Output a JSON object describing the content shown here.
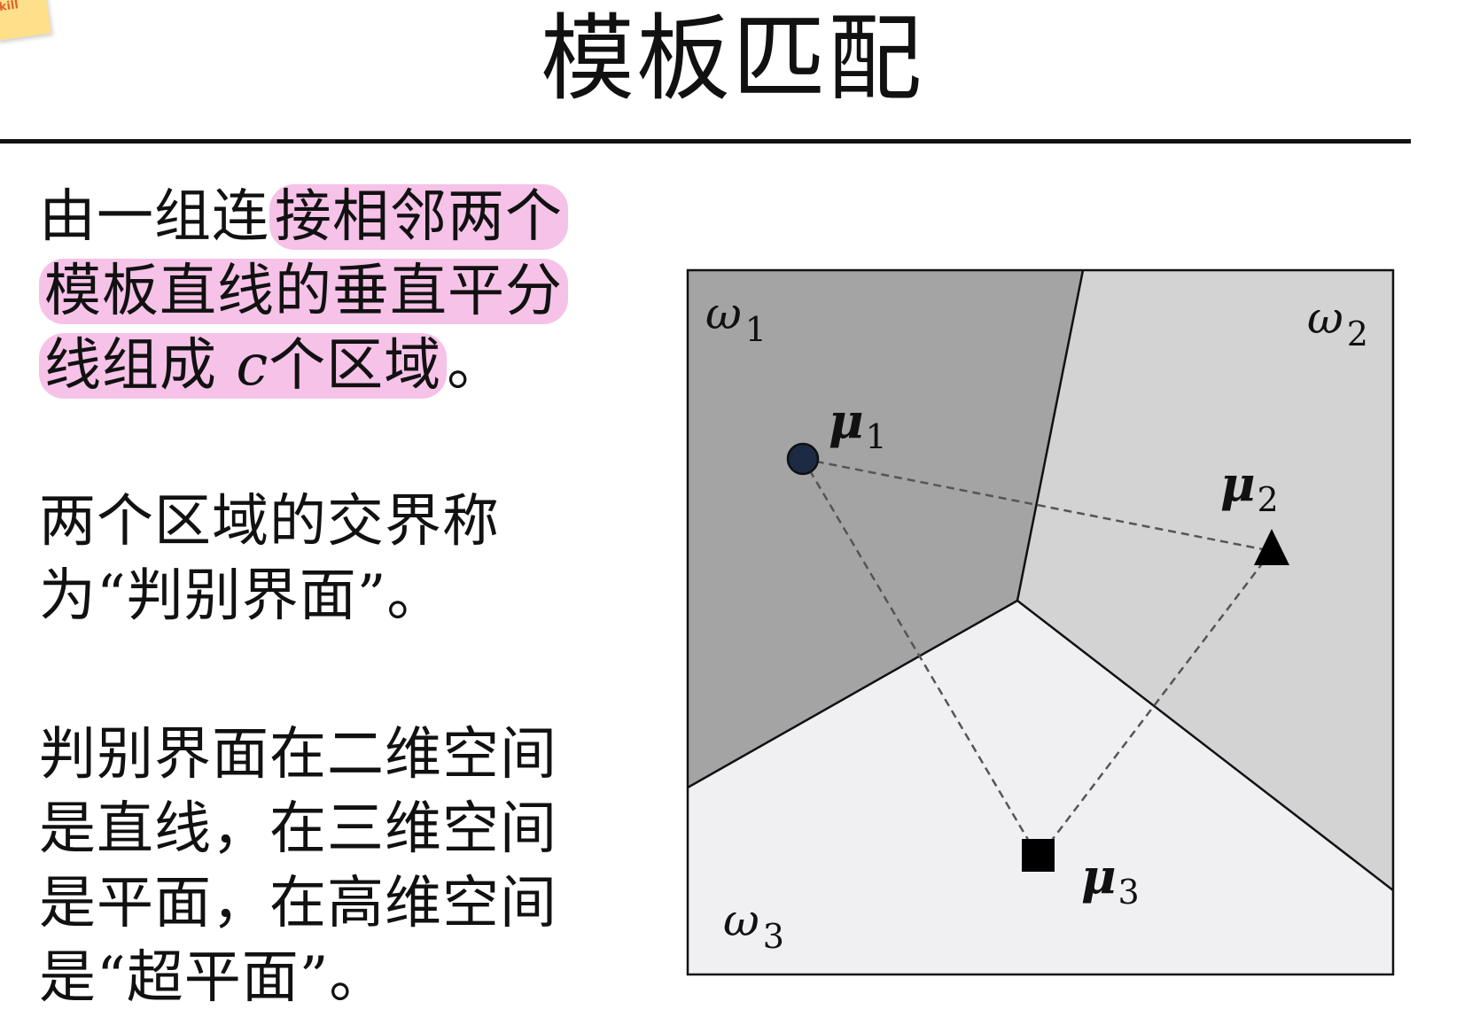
{
  "sticky_note": {
    "text": "kill"
  },
  "title": "模板匹配",
  "paragraphs": {
    "p1": {
      "before": "由一组连",
      "highlight": "接相邻两个模板直线的垂直平分线组成",
      "var": "c",
      "highlight_end": "个区域",
      "after": "。"
    },
    "p2": "两个区域的交界称为“判别界面”。",
    "p3": "判别界面在二维空间是直线，在三维空间是平面，在高维空间是“超平面”。"
  },
  "diagram": {
    "regions": [
      {
        "label": "ω",
        "sub": "1",
        "fill": "#a4a4a4"
      },
      {
        "label": "ω",
        "sub": "2",
        "fill": "#d3d3d3"
      },
      {
        "label": "ω",
        "sub": "3",
        "fill": "#f0f0f2"
      }
    ],
    "templates": [
      {
        "label": "μ",
        "sub": "1",
        "marker": "circle",
        "color": "#1c2a44"
      },
      {
        "label": "μ",
        "sub": "2",
        "marker": "triangle",
        "color": "#000000"
      },
      {
        "label": "μ",
        "sub": "3",
        "marker": "square",
        "color": "#000000"
      }
    ],
    "highlight_color": "#eb78cd"
  }
}
